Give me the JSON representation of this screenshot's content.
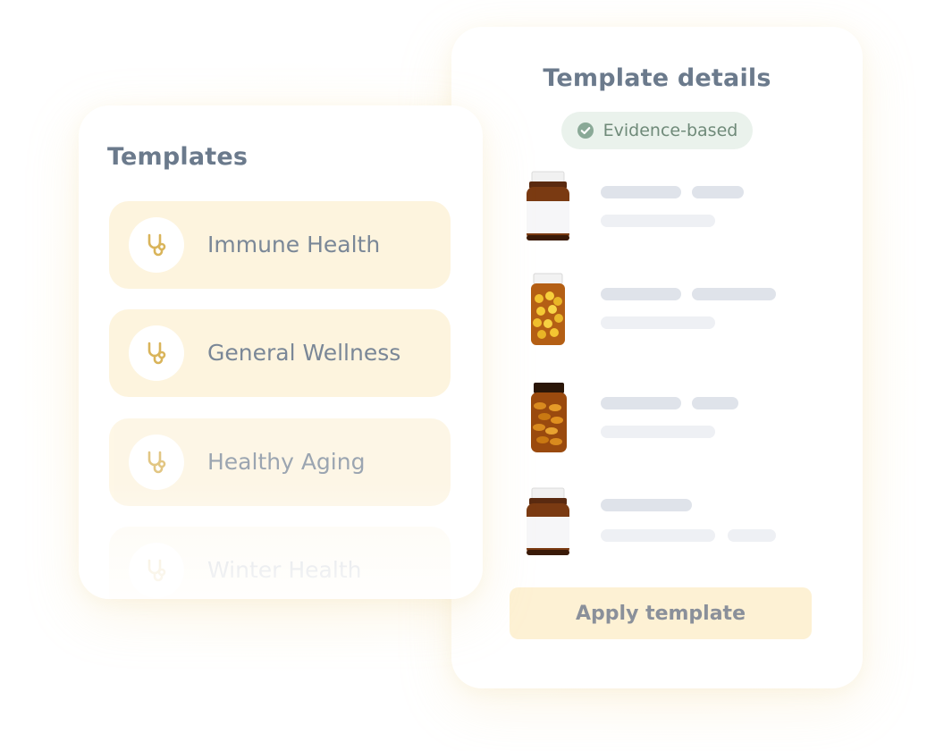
{
  "templates_panel": {
    "title": "Templates",
    "items": [
      {
        "label": "Immune Health",
        "icon": "stethoscope-icon"
      },
      {
        "label": "General Wellness",
        "icon": "stethoscope-icon"
      },
      {
        "label": "Healthy Aging",
        "icon": "stethoscope-icon"
      },
      {
        "label": "Winter Health",
        "icon": "stethoscope-icon"
      }
    ]
  },
  "details_panel": {
    "title": "Template details",
    "badge": {
      "label": "Evidence-based",
      "icon": "check-circle-icon"
    },
    "products": [
      {
        "bottle": "amber-bottle-white-label"
      },
      {
        "bottle": "clear-bottle-yellow-capsules"
      },
      {
        "bottle": "amber-bottle-softgels"
      },
      {
        "bottle": "amber-bottle-white-label"
      }
    ],
    "apply_button": "Apply template"
  },
  "colors": {
    "item_background": "#fdf4de",
    "icon_gold": "#d9b45a",
    "title_text": "#6b7a8c",
    "badge_background": "#eaf2ec",
    "badge_check": "#8aa997",
    "button_background": "#fdf1d4"
  }
}
